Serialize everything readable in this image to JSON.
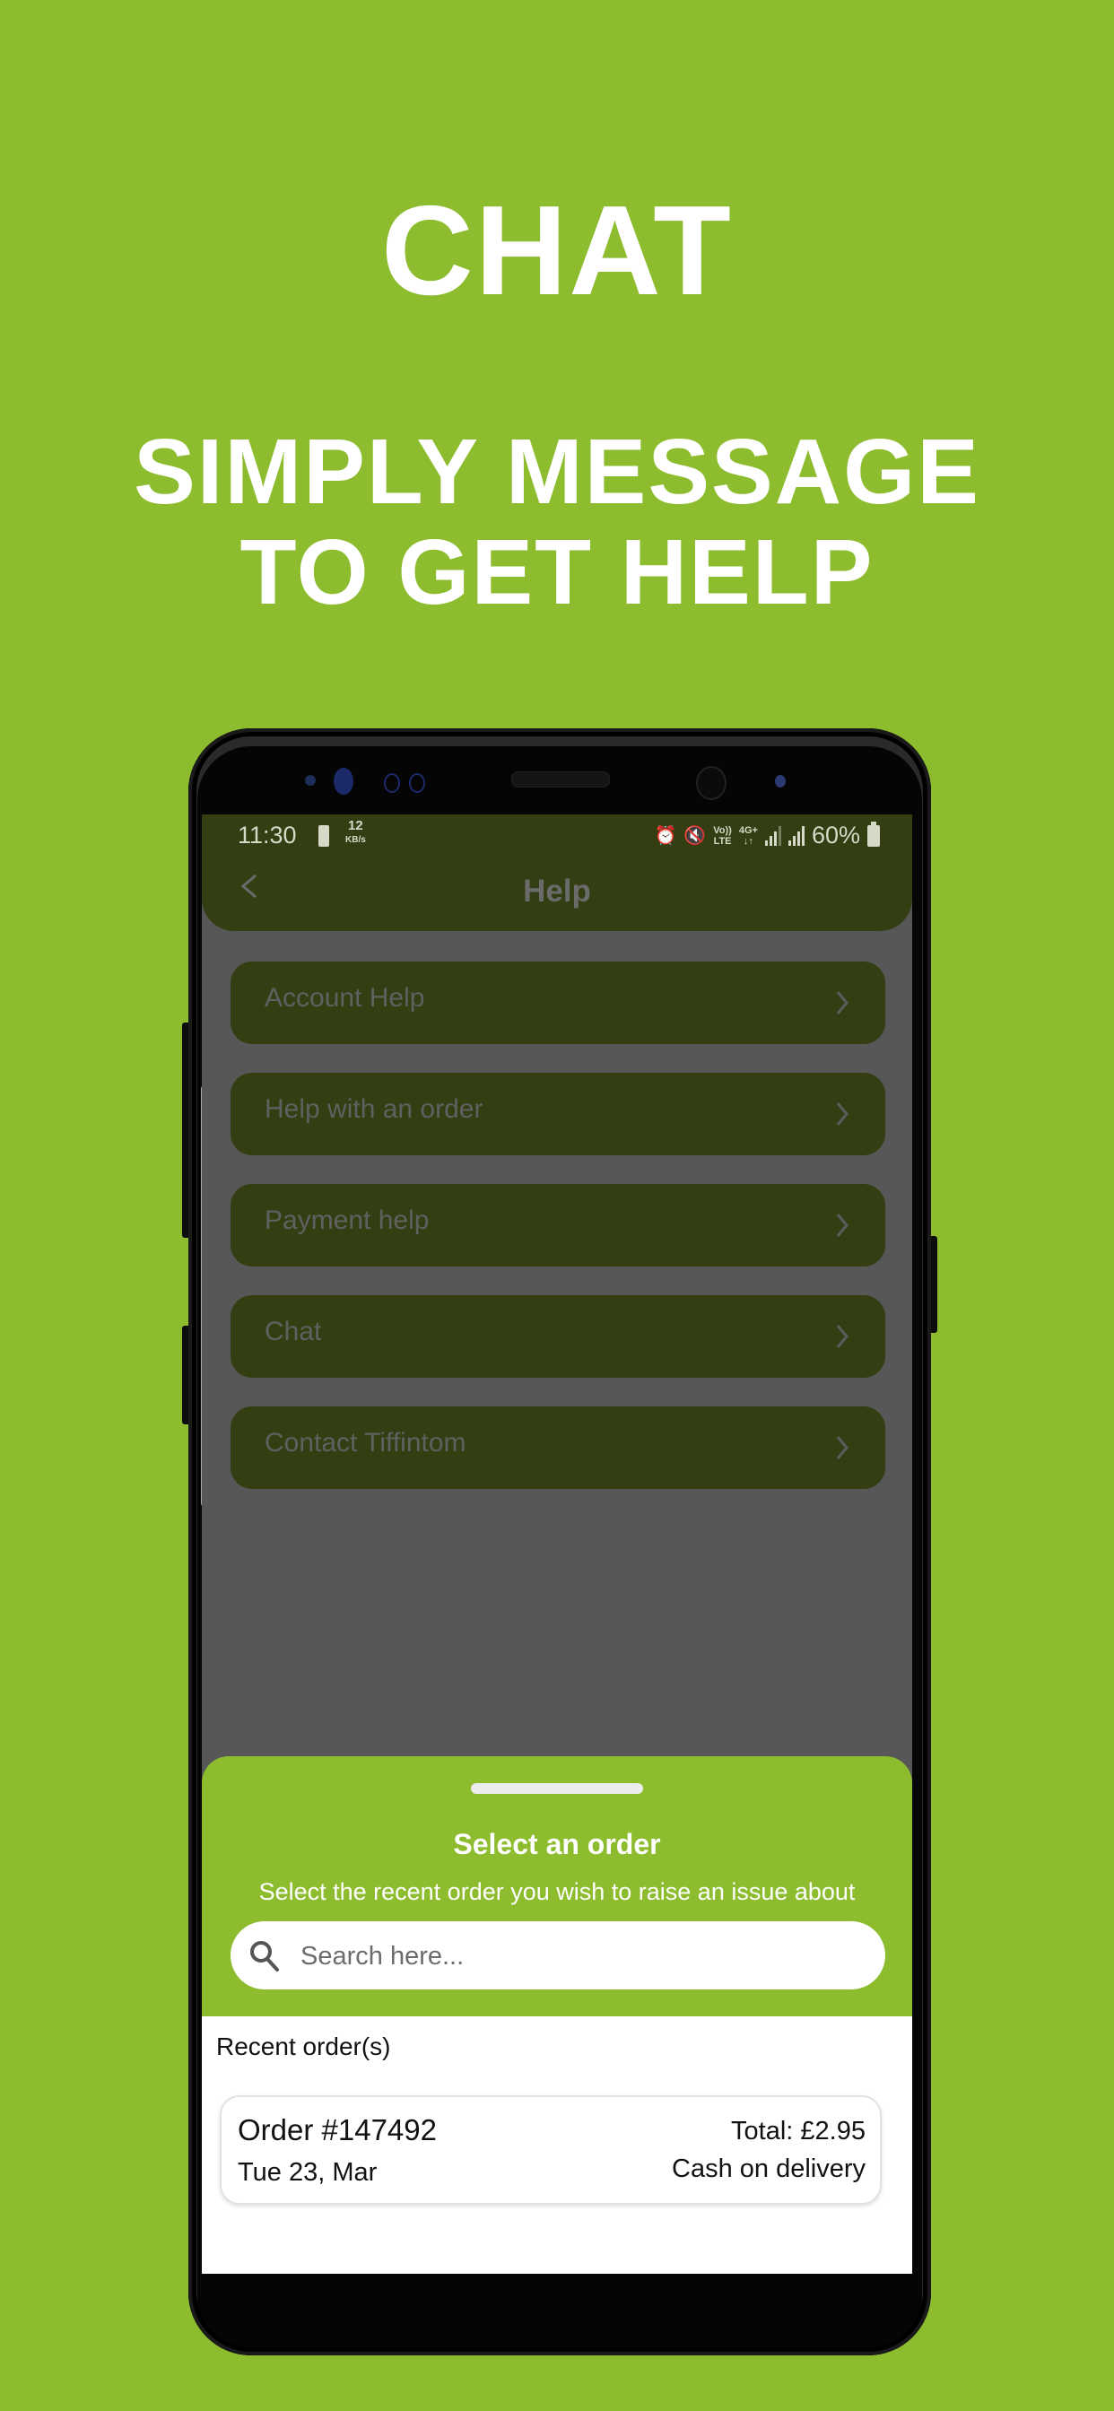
{
  "promo": {
    "title": "CHAT",
    "subtitle_line1": "SIMPLY MESSAGE",
    "subtitle_line2": "TO GET HELP"
  },
  "status_bar": {
    "time": "11:30",
    "net_speed_value": "12",
    "net_speed_unit": "KB/s",
    "volte_label_top": "Vo))",
    "volte_label_bottom": "LTE",
    "network_label_top": "4G+",
    "network_label_bottom": "↓↑",
    "battery_percent": "60%",
    "icons": [
      "battery-saver-icon",
      "alarm-icon",
      "mute-vibrate-icon",
      "volte-icon",
      "4g-icon",
      "signal-icon",
      "signal-icon",
      "battery-icon"
    ]
  },
  "app_bar": {
    "title": "Help",
    "back_icon": "chevron-left-icon"
  },
  "menu": {
    "items": [
      {
        "label": "Account Help"
      },
      {
        "label": "Help with an order"
      },
      {
        "label": "Payment help"
      },
      {
        "label": "Chat"
      },
      {
        "label": "Contact Tiffintom"
      }
    ]
  },
  "sheet": {
    "title": "Select an order",
    "subtitle": "Select the recent order you wish to raise an issue about",
    "search_placeholder": "Search here...",
    "search_value": "",
    "recent_label": "Recent order(s)",
    "orders": [
      {
        "id": "Order #147492",
        "date": "Tue 23, Mar",
        "total": "Total: £2.95",
        "payment": "Cash on delivery"
      }
    ]
  },
  "colors": {
    "brand_green": "#8dbd2f",
    "dimmed_green": "#333f13",
    "overlay_gray": "#575757"
  }
}
